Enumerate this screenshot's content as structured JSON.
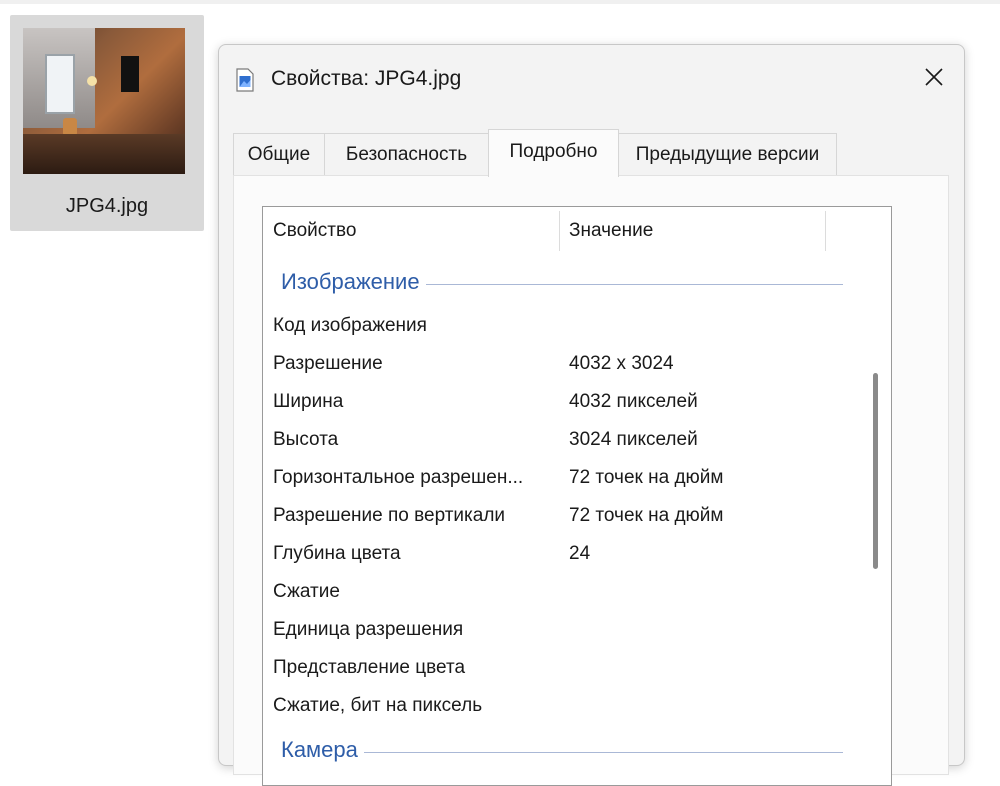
{
  "file_tile": {
    "name": "JPG4.jpg"
  },
  "dialog": {
    "title": "Свойства: JPG4.jpg",
    "tabs": [
      {
        "label": "Общие"
      },
      {
        "label": "Безопасность"
      },
      {
        "label": "Подробно",
        "active": true
      },
      {
        "label": "Предыдущие версии"
      }
    ],
    "columns": {
      "property": "Свойство",
      "value": "Значение"
    },
    "groups": {
      "image": "Изображение",
      "camera": "Камера"
    },
    "rows": [
      {
        "name": "Код изображения",
        "value": ""
      },
      {
        "name": "Разрешение",
        "value": "4032 x 3024"
      },
      {
        "name": "Ширина",
        "value": "4032 пикселей"
      },
      {
        "name": "Высота",
        "value": "3024 пикселей"
      },
      {
        "name": "Горизонтальное разрешен...",
        "value": "72 точек на дюйм"
      },
      {
        "name": "Разрешение по вертикали",
        "value": "72 точек на дюйм"
      },
      {
        "name": "Глубина цвета",
        "value": "24"
      },
      {
        "name": "Сжатие",
        "value": ""
      },
      {
        "name": "Единица разрешения",
        "value": ""
      },
      {
        "name": "Представление цвета",
        "value": ""
      },
      {
        "name": "Сжатие, бит на пиксель",
        "value": ""
      }
    ]
  },
  "icons": {
    "title": "image-file-icon",
    "close": "close-icon"
  },
  "colors": {
    "group_header": "#2e5da8",
    "dialog_bg": "#f3f3f3",
    "tile_bg": "#d9d9d9"
  }
}
